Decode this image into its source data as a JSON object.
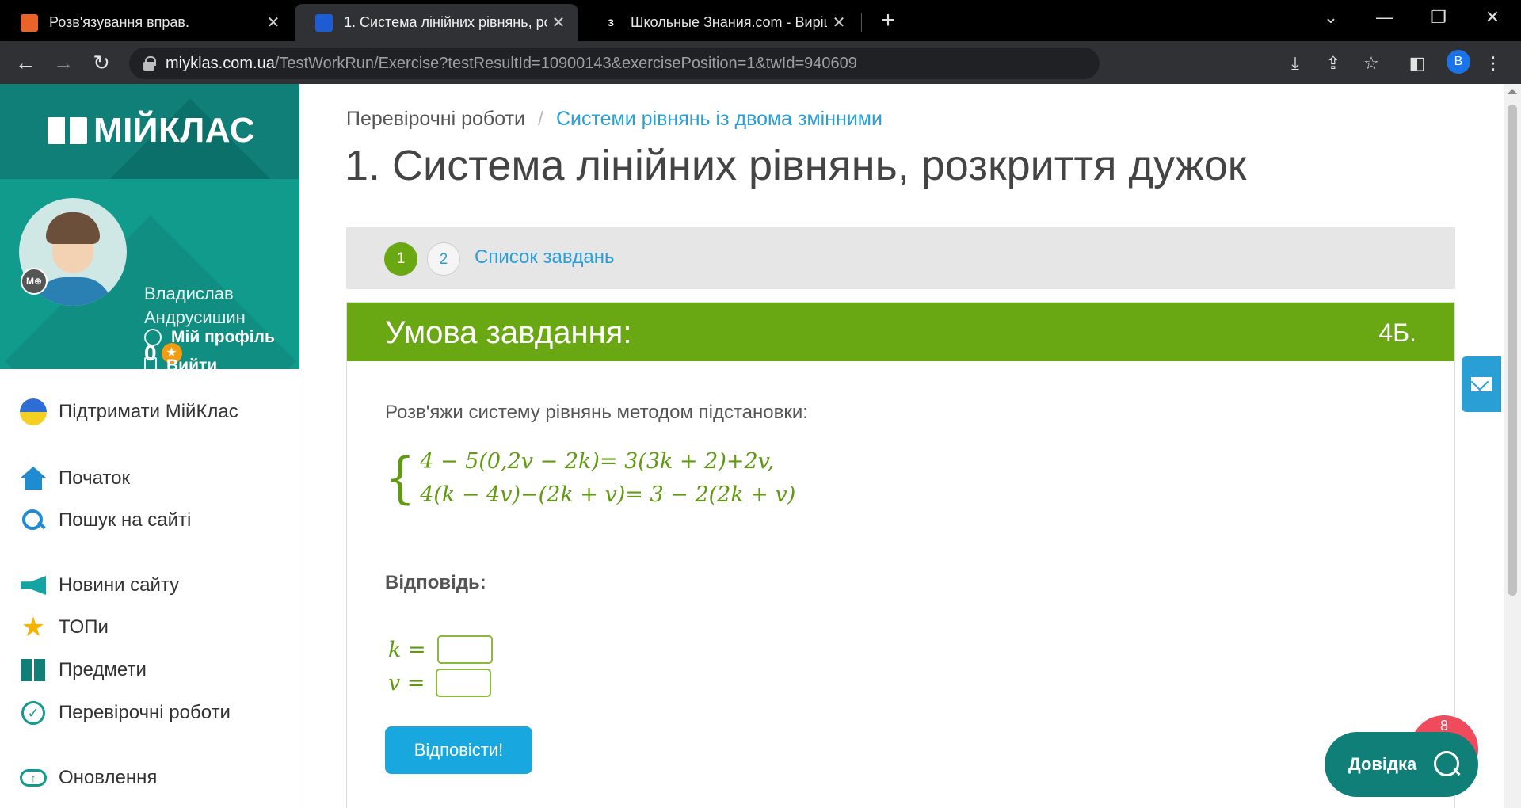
{
  "browser": {
    "tabs": [
      {
        "title": "Розв'язування вправ.",
        "active": false
      },
      {
        "title": "1. Система лінійних рівнянь, ро",
        "active": true
      },
      {
        "title": "Школьные Знания.com - Виріш",
        "active": false
      }
    ],
    "url_host": "miyklas.com.ua",
    "url_path": "/TestWorkRun/Exercise?testResultId=10900143&exercisePosition=1&twId=940609",
    "profile_initial": "B"
  },
  "sidebar": {
    "brand": "МІЙКЛАС",
    "user": {
      "name": "Владислав Андрусишин",
      "score": "0",
      "badge": "M⊕"
    },
    "user_links": {
      "profile": "Мій профіль",
      "logout": "Вийти"
    },
    "menu": {
      "support": "Підтримати МійКлас",
      "home": "Початок",
      "search": "Пошук на сайті",
      "news": "Новини сайту",
      "tops": "ТОПи",
      "subjects": "Предмети",
      "tests": "Перевірочні роботи",
      "updates": "Оновлення"
    }
  },
  "main": {
    "breadcrumb": {
      "root": "Перевірочні роботи",
      "sep": "/",
      "current": "Системи рівнянь із двома змінними"
    },
    "title": "1. Система лінійних рівнянь, розкриття дужок",
    "steps": [
      "1",
      "2"
    ],
    "task_list": "Список завдань",
    "card": {
      "heading": "Умова завдання:",
      "points": "4Б.",
      "prompt": "Розв'яжи систему рівнянь методом підстановки:",
      "brace": "{",
      "equations": [
        "4 − 5(0,2v − 2k)= 3(3k + 2)+2v,",
        "4(k − 4v)−(2k + v)= 3 − 2(2k + v)"
      ],
      "answer_label": "Відповідь:",
      "answers": [
        {
          "var": "k =",
          "value": ""
        },
        {
          "var": "v =",
          "value": ""
        }
      ],
      "submit": "Відповісти!"
    }
  },
  "floating": {
    "help": "Довідка",
    "notif_count": "8"
  }
}
